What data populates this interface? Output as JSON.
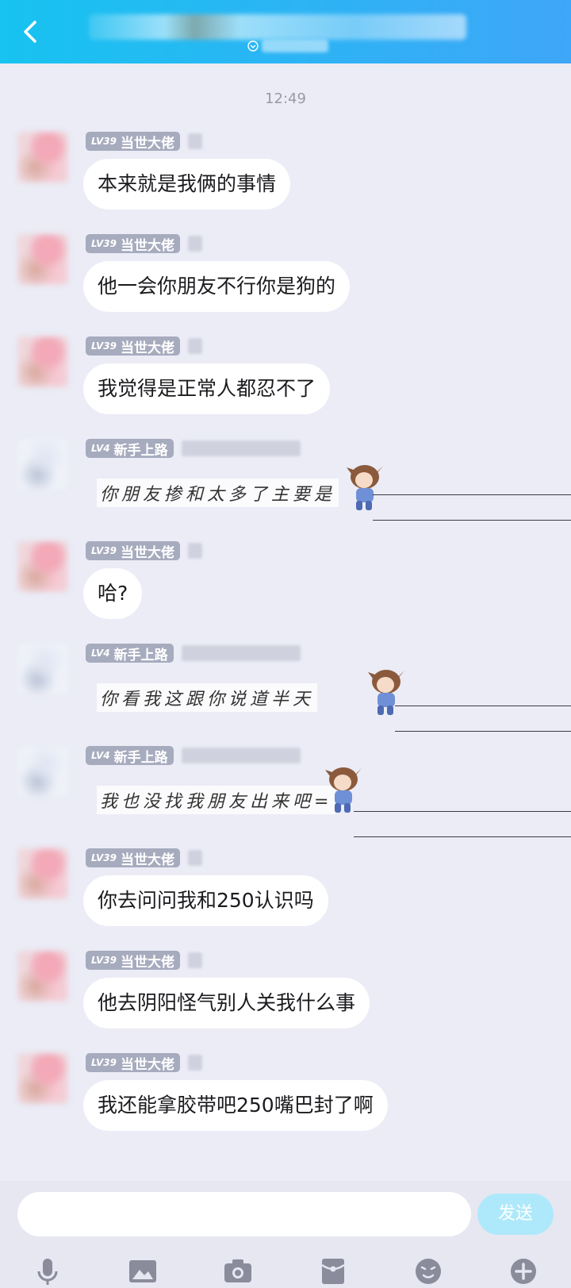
{
  "header": {},
  "timestamp": "12:49",
  "ranks": {
    "vet": {
      "level": "LV39",
      "title": "当世大佬"
    },
    "new": {
      "level": "LV4",
      "title": "新手上路"
    }
  },
  "messages": [
    {
      "text": "本来就是我俩的事情"
    },
    {
      "text": "他一会你朋友不行你是狗的"
    },
    {
      "text": "我觉得是正常人都忍不了"
    },
    {
      "text": "你朋友掺和太多了主要是"
    },
    {
      "text": "哈?"
    },
    {
      "text": "你看我这跟你说道半天"
    },
    {
      "text": "我也没找我朋友出来吧="
    },
    {
      "text": "你去问问我和250认识吗"
    },
    {
      "text": "他去阴阳怪气别人关我什么事"
    },
    {
      "text": "我还能拿胶带吧250嘴巴封了啊"
    }
  ],
  "composer": {
    "placeholder": "",
    "send_label": "发送"
  },
  "toolbar": {
    "icons": [
      "mic-icon",
      "image-icon",
      "camera-icon",
      "red-packet-icon",
      "emoji-icon",
      "plus-icon"
    ]
  },
  "colors": {
    "header": "#17c3f0",
    "background": "#ebecf6",
    "badge": "#a7abbe",
    "send": "#aee9fb"
  }
}
